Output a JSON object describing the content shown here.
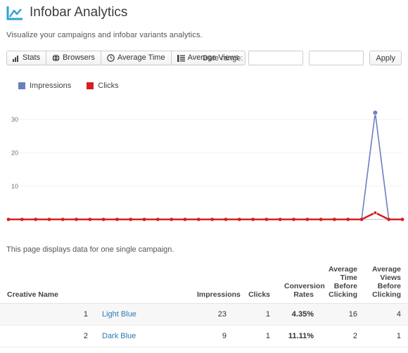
{
  "header": {
    "title": "Infobar Analytics",
    "icon": "analytics-chart-icon",
    "icon_color": "#2aa3d8",
    "subtitle": "Visualize your campaigns and infobar variants analytics."
  },
  "toolbar": {
    "buttons": [
      {
        "label": "Stats",
        "icon": "bar-chart-icon"
      },
      {
        "label": "Browsers",
        "icon": "globe-icon"
      },
      {
        "label": "Average Time",
        "icon": "clock-icon"
      },
      {
        "label": "Average Views",
        "icon": "list-icon"
      }
    ],
    "date_range_label": "Date range:",
    "date_from": "",
    "date_from_placeholder": "",
    "date_to": "",
    "date_to_placeholder": "",
    "apply_label": "Apply"
  },
  "note": "This page displays data for one single campaign.",
  "chart_data": {
    "type": "line",
    "title": "",
    "xlabel": "",
    "ylabel": "",
    "ylim": [
      0,
      35
    ],
    "yticks": [
      10,
      20,
      30
    ],
    "grid": true,
    "legend_position": "top-left",
    "legend": [
      "Impressions",
      "Clicks"
    ],
    "colors": {
      "impressions": "#6b7fc0",
      "clicks": "#d62020"
    },
    "x": [
      1,
      2,
      3,
      4,
      5,
      6,
      7,
      8,
      9,
      10,
      11,
      12,
      13,
      14,
      15,
      16,
      17,
      18,
      19,
      20,
      21,
      22,
      23,
      24,
      25,
      26,
      27,
      28,
      29,
      30
    ],
    "series": [
      {
        "name": "Impressions",
        "color": "#6b7fc0",
        "values": [
          0,
          0,
          0,
          0,
          0,
          0,
          0,
          0,
          0,
          0,
          0,
          0,
          0,
          0,
          0,
          0,
          0,
          0,
          0,
          0,
          0,
          0,
          0,
          0,
          0,
          0,
          0,
          32,
          0,
          0
        ]
      },
      {
        "name": "Clicks",
        "color": "#d62020",
        "values": [
          0,
          0,
          0,
          0,
          0,
          0,
          0,
          0,
          0,
          0,
          0,
          0,
          0,
          0,
          0,
          0,
          0,
          0,
          0,
          0,
          0,
          0,
          0,
          0,
          0,
          0,
          0,
          2,
          0,
          0
        ]
      }
    ]
  },
  "table": {
    "columns": [
      {
        "key": "name",
        "label": "Creative Name",
        "align": "left"
      },
      {
        "key": "impressions",
        "label": "Impressions",
        "align": "right"
      },
      {
        "key": "clicks",
        "label": "Clicks",
        "align": "right"
      },
      {
        "key": "conversion",
        "label": "Conversion Rates",
        "align": "right"
      },
      {
        "key": "avg_time",
        "label": "Average Time Before Clicking",
        "align": "right"
      },
      {
        "key": "avg_views",
        "label": "Average Views Before Clicking",
        "align": "right"
      }
    ],
    "rows": [
      {
        "index": "1",
        "name": "Light Blue",
        "impressions": "23",
        "clicks": "1",
        "conversion": "4.35%",
        "avg_time": "16",
        "avg_views": "4"
      },
      {
        "index": "2",
        "name": "Dark Blue",
        "impressions": "9",
        "clicks": "1",
        "conversion": "11.11%",
        "avg_time": "2",
        "avg_views": "1"
      }
    ]
  }
}
